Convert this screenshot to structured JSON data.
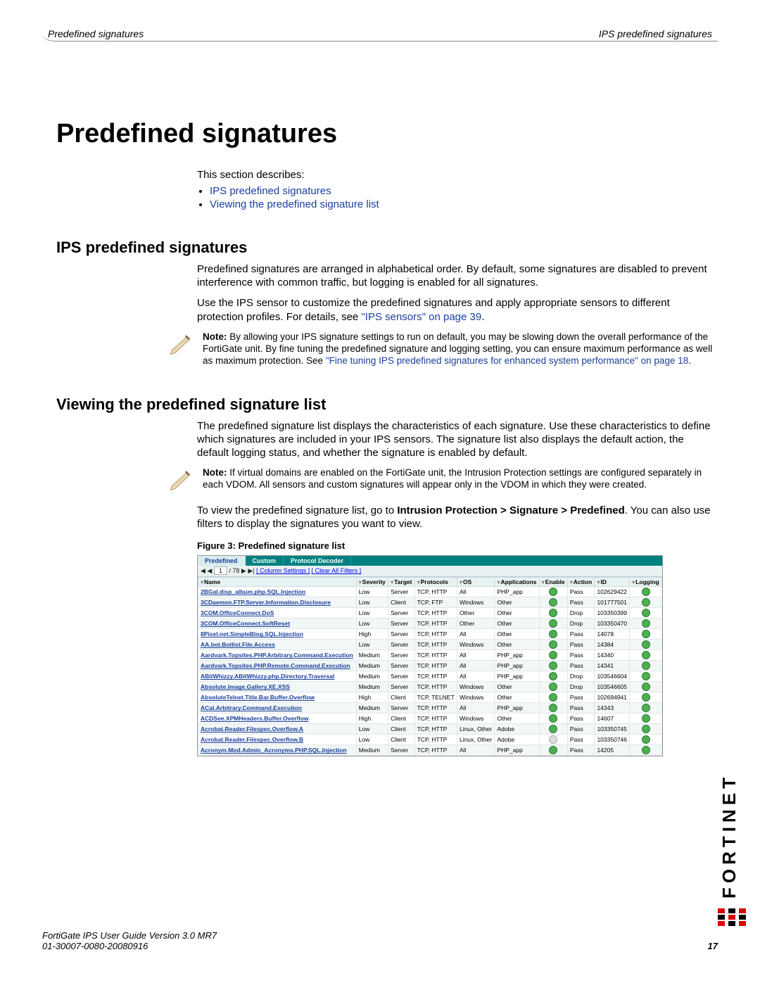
{
  "header": {
    "left": "Predefined signatures",
    "right": "IPS predefined signatures"
  },
  "title": "Predefined signatures",
  "intro": {
    "lead": "This section describes:",
    "links": [
      "IPS predefined signatures",
      "Viewing the predefined signature list"
    ]
  },
  "sec1": {
    "heading": "IPS predefined signatures",
    "p1": "Predefined signatures are arranged in alphabetical order. By default, some signatures are disabled to prevent interference with common traffic, but logging is enabled for all signatures.",
    "p2a": "Use the IPS sensor to customize the predefined signatures and apply appropriate sensors to different protection profiles. For details, see ",
    "p2link": "\"IPS sensors\" on page 39",
    "p2b": ".",
    "note_a": " By allowing your IPS signature settings to run on default, you may be slowing down the overall performance of the FortiGate unit. By fine tuning the predefined signature and logging setting, you can ensure maximum performance as well as maximum protection. See ",
    "note_link": "\"Fine tuning IPS predefined signatures for enhanced system performance\" on page 18",
    "note_b": "."
  },
  "sec2": {
    "heading": "Viewing the predefined signature list",
    "p1": "The predefined signature list displays the characteristics of each signature. Use these characteristics to define which signatures are included in your IPS sensors. The signature list also displays the default action, the default logging status, and whether the signature is enabled by default.",
    "note": " If virtual domains are enabled on the FortiGate unit, the Intrusion Protection settings are configured separately in each VDOM. All sensors and custom signatures will appear only in the VDOM in which they were created.",
    "p2a": "To view the predefined signature list, go to ",
    "p2b": "Intrusion Protection > Signature > Predefined",
    "p2c": ". You can also use filters to display the signatures you want to view.",
    "fig_caption": "Figure 3:   Predefined signature list"
  },
  "shot": {
    "tabs": [
      "Predefined",
      "Custom",
      "Protocol Decoder"
    ],
    "toolbar": {
      "page": "1",
      "total": "/ 78",
      "col": "[ Column Settings ]",
      "clr": "[ Clear All Filters ]"
    },
    "cols": [
      "Name",
      "Severity",
      "Target",
      "Protocols",
      "OS",
      "Applications",
      "Enable",
      "Action",
      "ID",
      "Logging"
    ],
    "rows": [
      {
        "name": "2BGal.disp_album.php.SQL.Injection",
        "sev": "Low",
        "tgt": "Server",
        "proto": "TCP, HTTP",
        "os": "All",
        "app": "PHP_app",
        "en": true,
        "act": "Pass",
        "id": "102629422"
      },
      {
        "name": "3CDaemon.FTP.Server.Information.Disclosure",
        "sev": "Low",
        "tgt": "Client",
        "proto": "TCP, FTP",
        "os": "Windows",
        "app": "Other",
        "en": true,
        "act": "Pass",
        "id": "101777501"
      },
      {
        "name": "3COM.OfficeConnect.DoS",
        "sev": "Low",
        "tgt": "Server",
        "proto": "TCP, HTTP",
        "os": "Other",
        "app": "Other",
        "en": true,
        "act": "Drop",
        "id": "103350399"
      },
      {
        "name": "3COM.OfficeConnect.SoftReset",
        "sev": "Low",
        "tgt": "Server",
        "proto": "TCP, HTTP",
        "os": "Other",
        "app": "Other",
        "en": true,
        "act": "Drop",
        "id": "103350470"
      },
      {
        "name": "8Pixel.net.SimpleBlog.SQL.Injection",
        "sev": "High",
        "tgt": "Server",
        "proto": "TCP, HTTP",
        "os": "All",
        "app": "Other",
        "en": true,
        "act": "Pass",
        "id": "14078"
      },
      {
        "name": "AA.bot.Botlist.File.Access",
        "sev": "Low",
        "tgt": "Server",
        "proto": "TCP, HTTP",
        "os": "Windows",
        "app": "Other",
        "en": true,
        "act": "Pass",
        "id": "14384"
      },
      {
        "name": "Aardvark.Topsites.PHP.Arbitrary.Command.Execution",
        "sev": "Medium",
        "tgt": "Server",
        "proto": "TCP, HTTP",
        "os": "All",
        "app": "PHP_app",
        "en": true,
        "act": "Pass",
        "id": "14340"
      },
      {
        "name": "Aardvark.Topsites.PHP.Remote.Command.Execution",
        "sev": "Medium",
        "tgt": "Server",
        "proto": "TCP, HTTP",
        "os": "All",
        "app": "PHP_app",
        "en": true,
        "act": "Pass",
        "id": "14341"
      },
      {
        "name": "ABitWhizzy.ABitWhizzy.php.Directory.Traversal",
        "sev": "Medium",
        "tgt": "Server",
        "proto": "TCP, HTTP",
        "os": "All",
        "app": "PHP_app",
        "en": true,
        "act": "Drop",
        "id": "103546604"
      },
      {
        "name": "Absolute.Image.Gallery.XE.XSS",
        "sev": "Medium",
        "tgt": "Server",
        "proto": "TCP, HTTP",
        "os": "Windows",
        "app": "Other",
        "en": true,
        "act": "Drop",
        "id": "103546605"
      },
      {
        "name": "AbsoluteTelnet.Title.Bar.Buffer.Overflow",
        "sev": "High",
        "tgt": "Client",
        "proto": "TCP, TELNET",
        "os": "Windows",
        "app": "Other",
        "en": true,
        "act": "Pass",
        "id": "102694941"
      },
      {
        "name": "ACal.Arbitrary.Command.Execution",
        "sev": "Medium",
        "tgt": "Server",
        "proto": "TCP, HTTP",
        "os": "All",
        "app": "PHP_app",
        "en": true,
        "act": "Pass",
        "id": "14343"
      },
      {
        "name": "ACDSee.XPMHeaders.Buffer.Overflow",
        "sev": "High",
        "tgt": "Client",
        "proto": "TCP, HTTP",
        "os": "Windows",
        "app": "Other",
        "en": true,
        "act": "Pass",
        "id": "14607"
      },
      {
        "name": "Acrobat.Reader.Filespec.Overflow.A",
        "sev": "Low",
        "tgt": "Client",
        "proto": "TCP, HTTP",
        "os": "Linux, Other",
        "app": "Adobe",
        "en": true,
        "act": "Pass",
        "id": "103350745"
      },
      {
        "name": "Acrobat.Reader.Filespec.Overflow.B",
        "sev": "Low",
        "tgt": "Client",
        "proto": "TCP, HTTP",
        "os": "Linux, Other",
        "app": "Adobe",
        "en": false,
        "act": "Pass",
        "id": "103350746"
      },
      {
        "name": "Acronym.Mod.Admin_Acronyms.PHP.SQL.Injection",
        "sev": "Medium",
        "tgt": "Server",
        "proto": "TCP, HTTP",
        "os": "All",
        "app": "PHP_app",
        "en": true,
        "act": "Pass",
        "id": "14205"
      }
    ]
  },
  "footer": {
    "l1": "FortiGate IPS User Guide Version 3.0 MR7",
    "l2": "01-30007-0080-20080916",
    "page": "17",
    "brand": "FORTINET"
  }
}
